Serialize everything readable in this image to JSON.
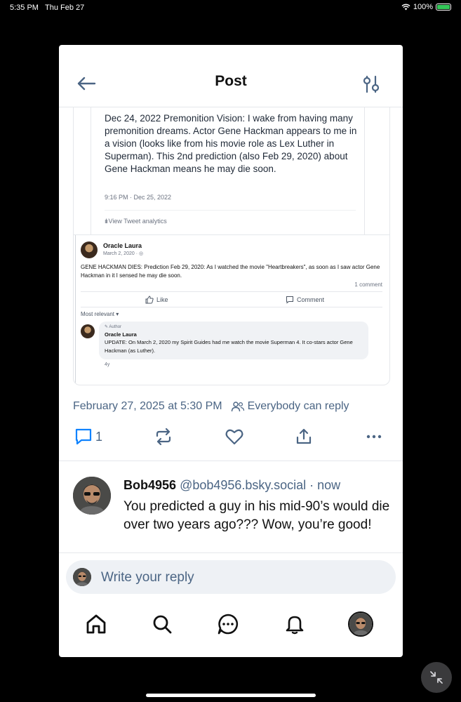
{
  "status_bar": {
    "time": "5:35 PM",
    "date": "Thu Feb 27",
    "battery": "100%"
  },
  "header": {
    "title": "Post",
    "back_icon": "arrow-left-icon",
    "filter_icon": "sliders-icon"
  },
  "embedded_image": {
    "tweet": {
      "text": "Dec 24, 2022 Premonition Vision: I wake from having many premonition dreams. Actor Gene Hackman appears to me in a vision (looks like from his movie role as Lex Luther in Superman). This 2nd prediction (also Feb 29, 2020) about Gene Hackman means he may die soon.",
      "timestamp": "9:16 PM · Dec 25, 2022",
      "analytics": "View Tweet analytics"
    },
    "facebook_post": {
      "author": "Oracle Laura",
      "date": "March 2, 2020 · ",
      "text": "GENE HACKMAN DIES: Prediction Feb 29, 2020: As I watched the movie \"Heartbreakers\", as soon as I saw actor Gene Hackman in it I sensed he may die soon.",
      "comment_count": "1 comment",
      "like_label": "Like",
      "comment_label": "Comment",
      "sort_label": "Most relevant",
      "comment": {
        "badge": "Author",
        "author": "Oracle Laura",
        "text": "UPDATE: On March 2, 2020 my Spirit Guides had me watch the movie Superman 4. It co-stars actor Gene Hackman (as Luther).",
        "age": "4y"
      }
    }
  },
  "post_meta": {
    "timestamp": "February 27, 2025 at 5:30 PM",
    "reply_setting": "Everybody can reply"
  },
  "actions": {
    "reply_count": "1"
  },
  "reply": {
    "author": "Bob4956",
    "handle": "@bob4956.bsky.social",
    "separator": " · ",
    "time": "now",
    "text": "You predicted a guy in his mid-90’s would die over two years ago???  Wow, you’re good!"
  },
  "composer": {
    "placeholder": "Write your reply"
  },
  "tabs": [
    "home-icon",
    "search-icon",
    "chat-icon",
    "bell-icon",
    "profile-avatar"
  ],
  "colors": {
    "accent": "#1083fe",
    "muted": "#4b6584",
    "background": "#000000"
  }
}
